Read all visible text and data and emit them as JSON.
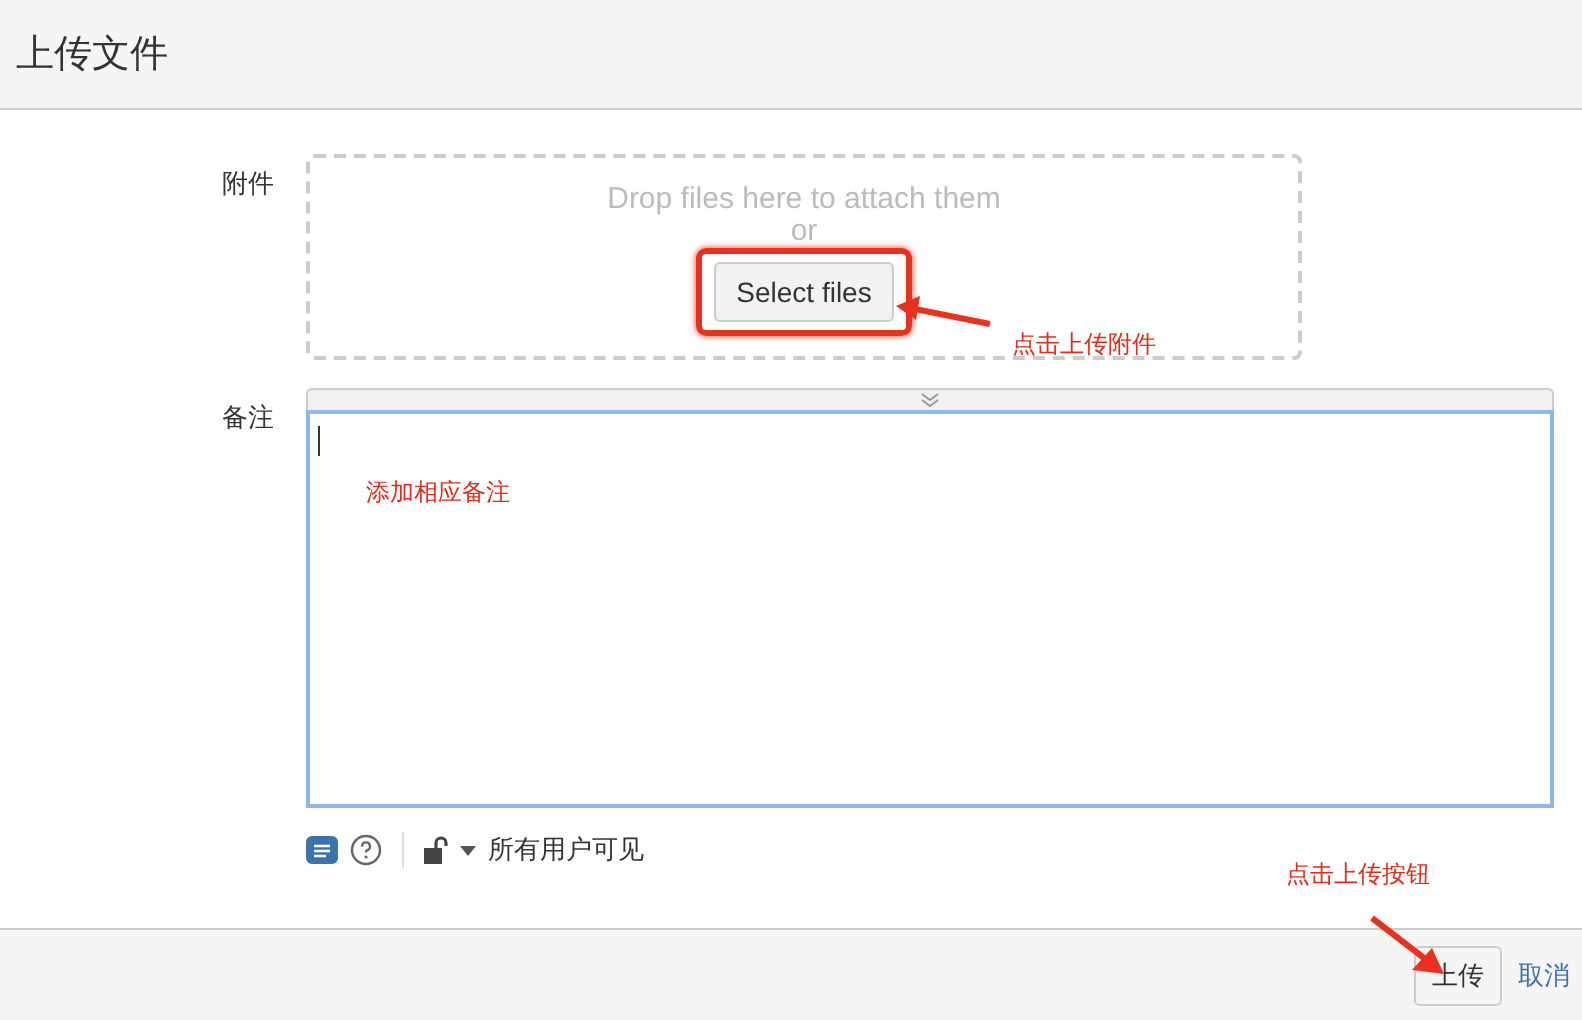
{
  "window": {
    "title": "上传文件"
  },
  "attachment": {
    "label": "附件",
    "drop_text": "Drop files here to attach them",
    "or_text": "or",
    "button": "Select files"
  },
  "note": {
    "label": "备注"
  },
  "toolbar": {
    "visibility": "所有用户可见"
  },
  "footer": {
    "buttons": [
      {
        "label": "上传",
        "kind": "button"
      },
      {
        "label": "取消",
        "kind": "link"
      }
    ]
  },
  "annotations": [
    {
      "text": "点击上传附件",
      "kind": "select"
    },
    {
      "text": "添加相应备注",
      "kind": "note"
    },
    {
      "text": "点击上传按钮",
      "kind": "upload"
    }
  ]
}
